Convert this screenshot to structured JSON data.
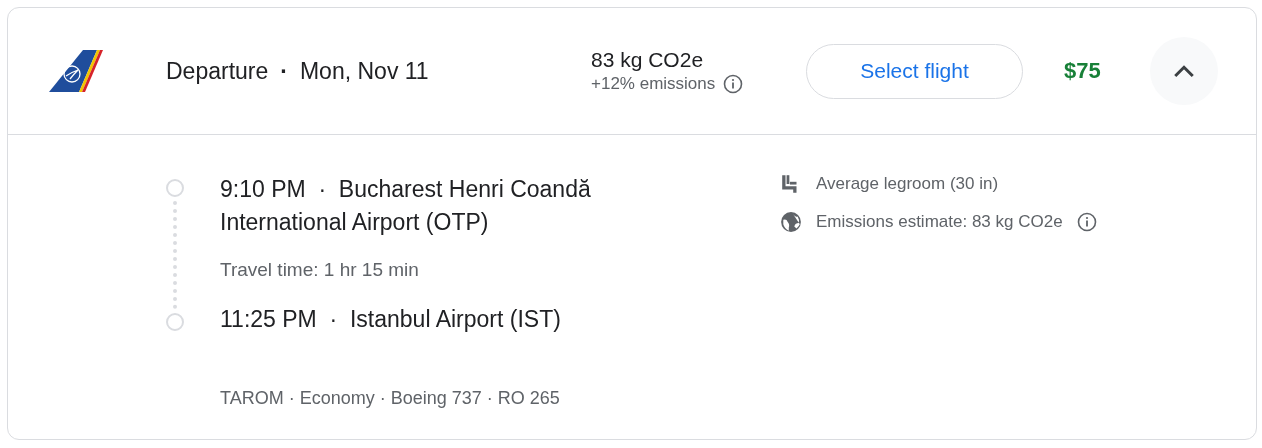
{
  "header": {
    "label": "Departure",
    "separator": "·",
    "date": "Mon, Nov 11",
    "emissions": "83 kg CO2e",
    "emissions_change": "+12% emissions",
    "select_button": "Select flight",
    "price": "$75",
    "expanded": true
  },
  "itinerary": {
    "separator": "·",
    "departure": {
      "time": "9:10 PM",
      "airport": "Bucharest Henri Coandă International Airport (OTP)"
    },
    "travel_time": "Travel time: 1 hr 15 min",
    "arrival": {
      "time": "11:25 PM",
      "airport": "Istanbul Airport (IST)"
    },
    "details": "TAROM · Economy · Boeing 737 · RO 265"
  },
  "amenities": [
    {
      "kind": "legroom",
      "text": "Average legroom (30 in)",
      "info": false
    },
    {
      "kind": "emissions",
      "text": "Emissions estimate: 83 kg CO2e",
      "info": true
    }
  ]
}
